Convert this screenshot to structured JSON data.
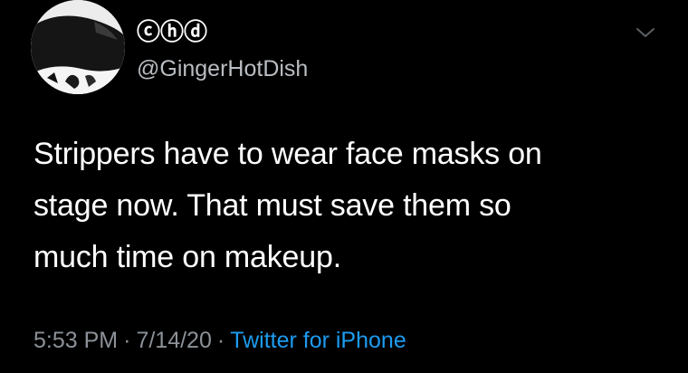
{
  "tweet": {
    "display_name": "ⓒⓗⓓ",
    "handle": "@GingerHotDish",
    "text_lines": [
      "Strippers have to wear face masks on",
      "stage now. That must save them so",
      "much time on makeup."
    ],
    "time": "5:53 PM",
    "date": "7/14/20",
    "separator": "·",
    "source": "Twitter for iPhone"
  },
  "icons": {
    "menu": "chevron-down-icon",
    "avatar": "profile-photo"
  },
  "colors": {
    "background": "#000000",
    "text": "#ffffff",
    "secondary": "#8b9197",
    "link": "#1d9bf0"
  }
}
